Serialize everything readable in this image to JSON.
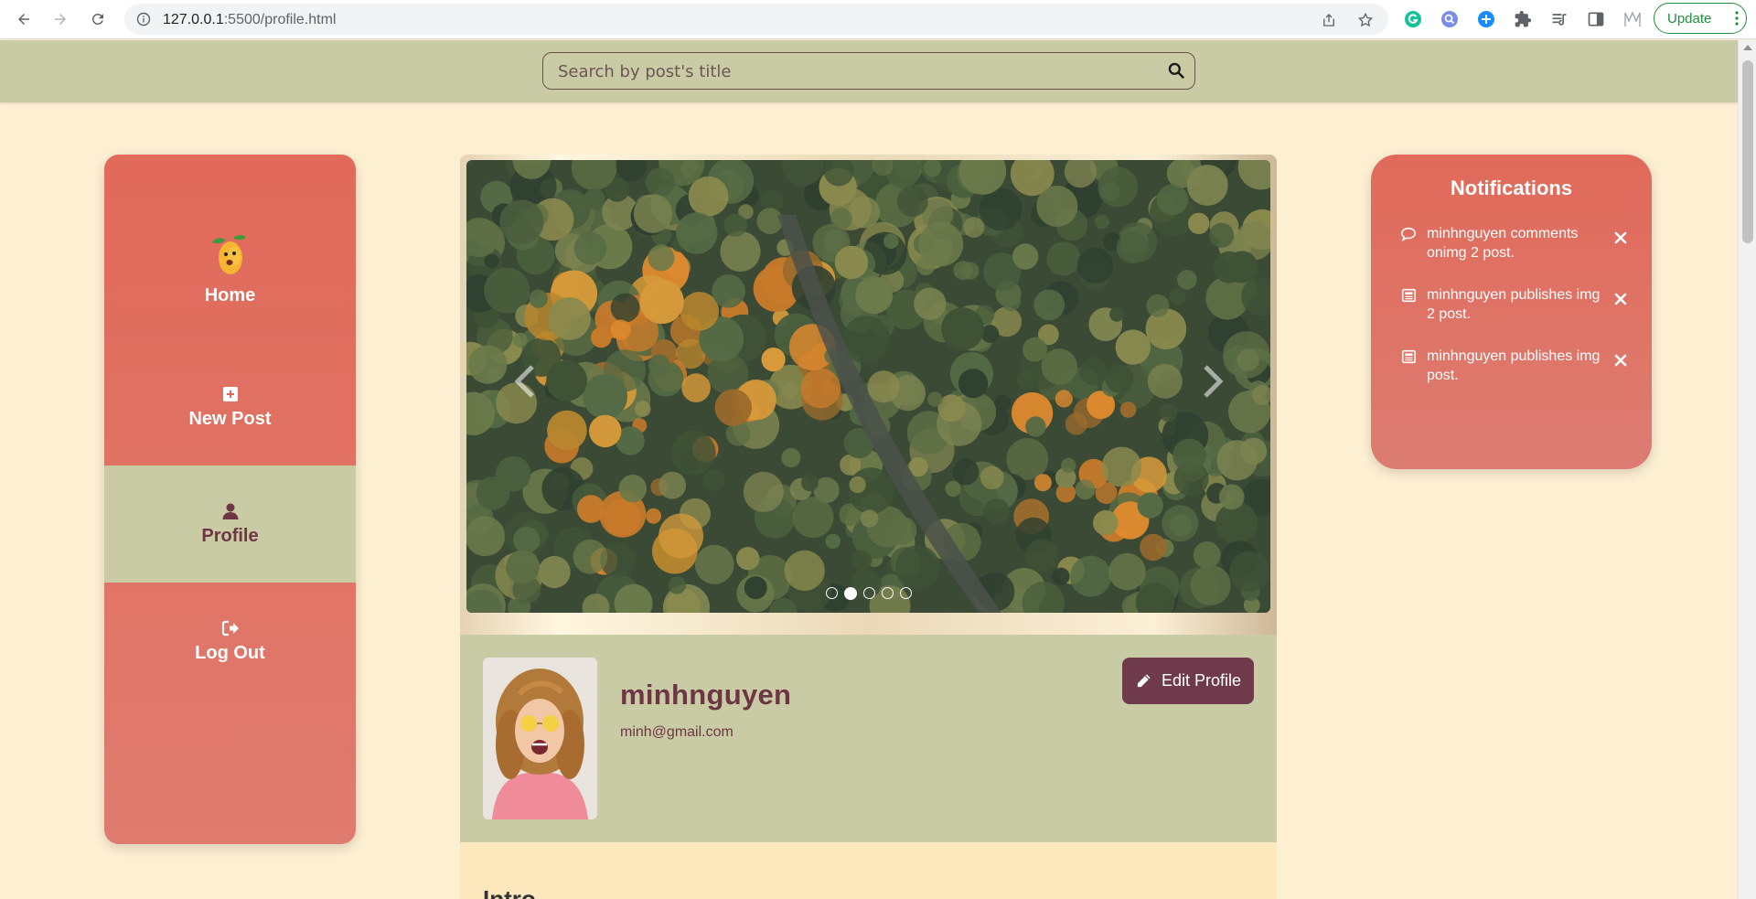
{
  "browser": {
    "url_host": "127.0.0.1",
    "url_rest": ":5500/profile.html",
    "update_label": "Update"
  },
  "search": {
    "placeholder": "Search by post's title"
  },
  "sidebar": {
    "items": [
      {
        "label": "Home",
        "icon": "mango-logo-icon",
        "active": false
      },
      {
        "label": "New Post",
        "icon": "plus-square-icon",
        "active": false
      },
      {
        "label": "Profile",
        "icon": "user-icon",
        "active": true
      },
      {
        "label": "Log Out",
        "icon": "logout-icon",
        "active": false
      }
    ]
  },
  "carousel": {
    "slide_count": 5,
    "active_index": 1
  },
  "profile": {
    "username": "minhnguyen",
    "email": "minh@gmail.com",
    "edit_label": "Edit Profile"
  },
  "intro": {
    "heading": "Intro"
  },
  "notifications": {
    "title": "Notifications",
    "items": [
      {
        "icon": "comment-icon",
        "text": "minhnguyen comments onimg 2 post."
      },
      {
        "icon": "newspaper-icon",
        "text": "minhnguyen publishes img 2 post."
      },
      {
        "icon": "newspaper-icon",
        "text": "minhnguyen publishes img post."
      }
    ]
  },
  "colors": {
    "accent": "#e16a5a",
    "olive": "#c8cba3",
    "maroon": "#6e3645",
    "background": "#fdefd2"
  }
}
